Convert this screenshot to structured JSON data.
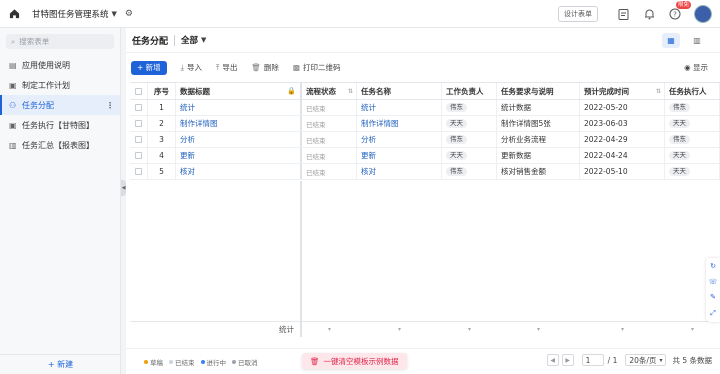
{
  "app": {
    "title": "甘特图任务管理系统",
    "design_label": "设计表单",
    "badge": "限免"
  },
  "sidebar": {
    "search_placeholder": "搜索表单",
    "items": [
      {
        "label": "应用使用说明",
        "icon": "doc-icon"
      },
      {
        "label": "制定工作计划",
        "icon": "form-icon"
      },
      {
        "label": "任务分配",
        "icon": "people-icon",
        "active": true
      },
      {
        "label": "任务执行【甘特图】",
        "icon": "form-icon"
      },
      {
        "label": "任务汇总【报表图】",
        "icon": "chart-icon"
      }
    ],
    "new_label": "+ 新建"
  },
  "page": {
    "title": "任务分配",
    "view": "全部"
  },
  "toolbar": {
    "new": "+ 新增",
    "import": "导入",
    "export": "导出",
    "delete": "删除",
    "print_qr": "打印二维码",
    "show": "显示"
  },
  "table": {
    "columns": [
      "序号",
      "数据标题",
      "流程状态",
      "任务名称",
      "工作负责人",
      "任务要求与说明",
      "预计完成时间",
      "任务执行人"
    ],
    "rows": [
      {
        "no": "1",
        "title": "统计",
        "state": "已结束",
        "name": "统计",
        "owner": "伟东",
        "req": "统计数据",
        "date": "2022-05-20",
        "exe": "伟东"
      },
      {
        "no": "2",
        "title": "制作详情图",
        "state": "已结束",
        "name": "制作详情图",
        "owner": "天天",
        "req": "制作详情图5张",
        "date": "2023-06-03",
        "exe": "天天"
      },
      {
        "no": "3",
        "title": "分析",
        "state": "已结束",
        "name": "分析",
        "owner": "伟东",
        "req": "分析业务流程",
        "date": "2022-04-29",
        "exe": "伟东"
      },
      {
        "no": "4",
        "title": "更新",
        "state": "已结束",
        "name": "更新",
        "owner": "天天",
        "req": "更新数据",
        "date": "2022-04-24",
        "exe": "天天"
      },
      {
        "no": "5",
        "title": "核对",
        "state": "已结束",
        "name": "核对",
        "owner": "伟东",
        "req": "核对销售金额",
        "date": "2022-05-10",
        "exe": "天天"
      }
    ],
    "summary_label": "统计"
  },
  "status": {
    "legend": [
      {
        "label": "草稿",
        "color": "#f59e0b"
      },
      {
        "label": "已结束",
        "color": "#cbd5e1"
      },
      {
        "label": "进行中",
        "color": "#3b82f6"
      },
      {
        "label": "已取消",
        "color": "#9ca3af"
      }
    ],
    "clear_label": "一键清空模板示例数据",
    "page": "1",
    "total_pages": "/ 1",
    "page_size": "20条/页",
    "total": "共 5 条数据"
  }
}
